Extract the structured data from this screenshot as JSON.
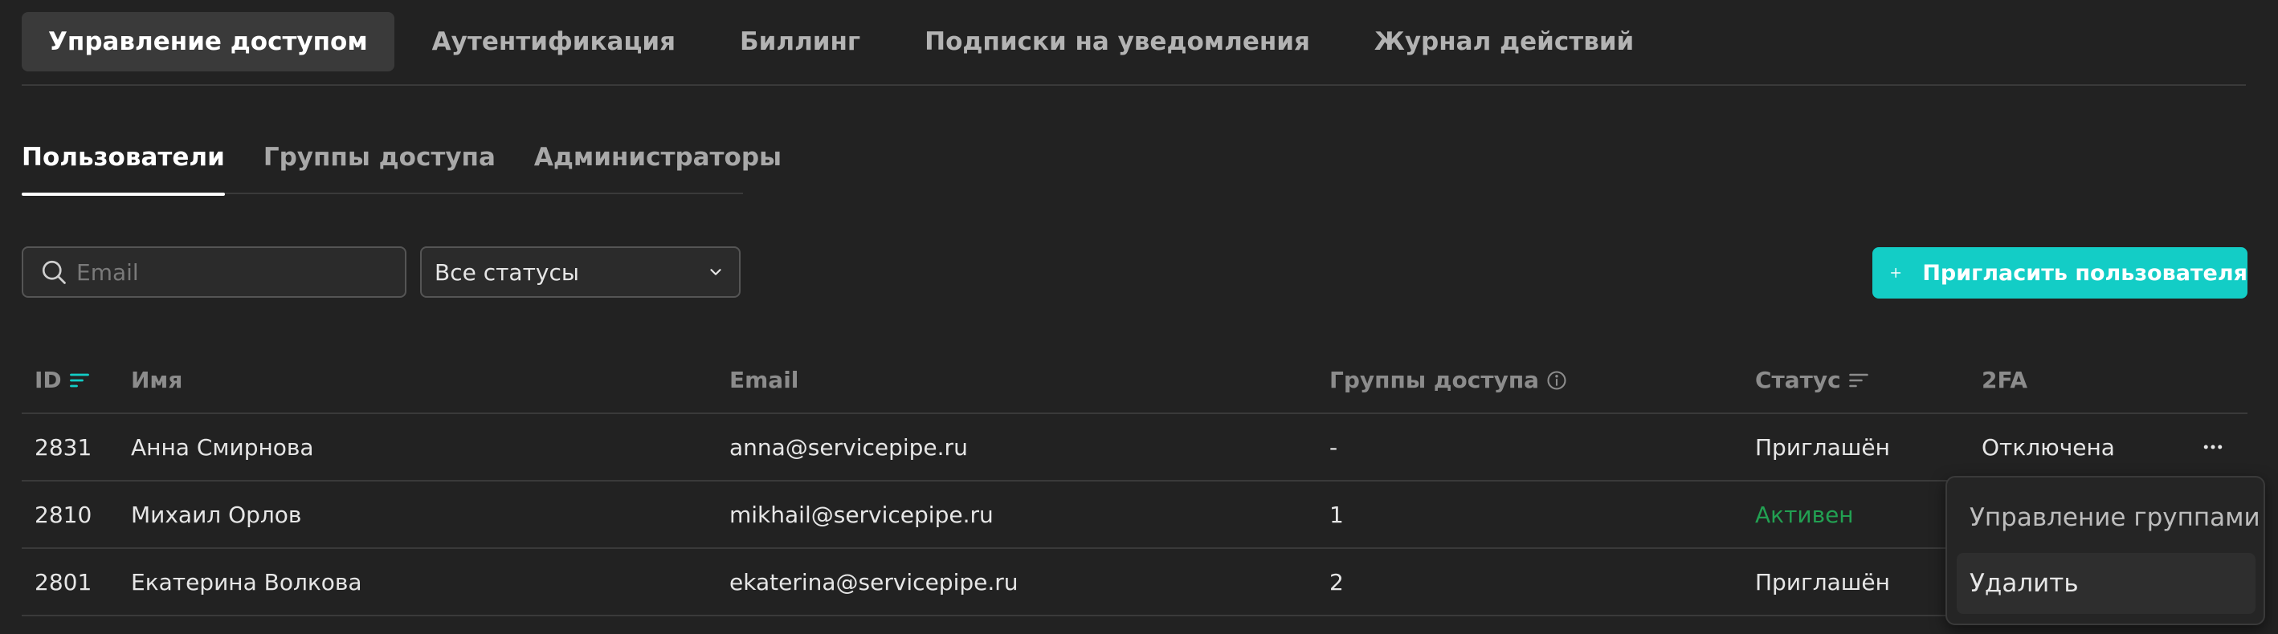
{
  "top_tabs": [
    {
      "label": "Управление доступом",
      "active": true
    },
    {
      "label": "Аутентификация",
      "active": false
    },
    {
      "label": "Биллинг",
      "active": false
    },
    {
      "label": "Подписки на уведомления",
      "active": false
    },
    {
      "label": "Журнал действий",
      "active": false
    }
  ],
  "sub_tabs": [
    {
      "label": "Пользователи",
      "active": true
    },
    {
      "label": "Группы доступа",
      "active": false
    },
    {
      "label": "Администраторы",
      "active": false
    }
  ],
  "search": {
    "placeholder": "Email",
    "value": ""
  },
  "status_filter": {
    "selected": "Все статусы"
  },
  "invite_button": {
    "label": "Пригласить пользователя"
  },
  "table": {
    "headers": {
      "id": "ID",
      "name": "Имя",
      "email": "Email",
      "groups": "Группы доступа",
      "status": "Статус",
      "twofa": "2FA"
    },
    "rows": [
      {
        "id": "2831",
        "name": "Анна Смирнова",
        "email": "anna@servicepipe.ru",
        "groups": "-",
        "status": "Приглашён",
        "twofa": "Отключена"
      },
      {
        "id": "2810",
        "name": "Михаил Орлов",
        "email": "mikhail@servicepipe.ru",
        "groups": "1",
        "status": "Активен",
        "twofa": ""
      },
      {
        "id": "2801",
        "name": "Екатерина Волкова",
        "email": "ekaterina@servicepipe.ru",
        "groups": "2",
        "status": "Приглашён",
        "twofa": ""
      }
    ]
  },
  "row_menu": {
    "items": [
      "Управление группами",
      "Удалить"
    ]
  },
  "colors": {
    "accent": "#13cdc6",
    "active_status": "#22a052",
    "background": "#222222"
  }
}
